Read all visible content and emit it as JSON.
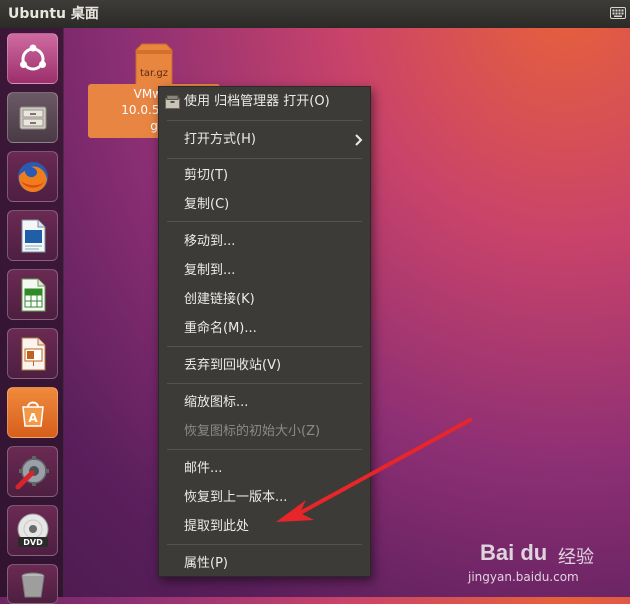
{
  "top_panel": {
    "title": "Ubuntu 桌面",
    "keyboard_icon": "keyboard-icon"
  },
  "launcher": {
    "items": [
      {
        "name": "ubuntu-dash-icon"
      },
      {
        "name": "files-icon"
      },
      {
        "name": "firefox-icon"
      },
      {
        "name": "writer-icon"
      },
      {
        "name": "calc-icon"
      },
      {
        "name": "impress-icon"
      },
      {
        "name": "software-center-icon"
      },
      {
        "name": "system-settings-icon"
      },
      {
        "name": "dvd-icon"
      },
      {
        "name": "trash-icon"
      }
    ]
  },
  "desktop_file": {
    "icon_text": "tar.gz",
    "label_line1": "VMwar",
    "label_line2": "10.0.5-322",
    "label_line3": "g"
  },
  "context_menu": {
    "items": [
      {
        "label": "使用 归档管理器 打开(O)",
        "icon": "archive-manager-icon"
      },
      {
        "label": "打开方式(H)",
        "submenu": true
      },
      {
        "label": "剪切(T)"
      },
      {
        "label": "复制(C)"
      },
      {
        "label": "移动到..."
      },
      {
        "label": "复制到..."
      },
      {
        "label": "创建链接(K)"
      },
      {
        "label": "重命名(M)..."
      },
      {
        "label": "丢弃到回收站(V)"
      },
      {
        "label": "缩放图标..."
      },
      {
        "label": "恢复图标的初始大小(Z)",
        "disabled": true
      },
      {
        "label": "邮件..."
      },
      {
        "label": "恢复到上一版本..."
      },
      {
        "label": "提取到此处"
      },
      {
        "label": "属性(P)"
      }
    ]
  },
  "annotation": {
    "color": "#e8262a"
  },
  "watermark": {
    "logo": "Bai du",
    "cn": "经验",
    "url": "jingyan.baidu.com"
  },
  "colors": {
    "panel": "#2b2a27",
    "menu_bg": "#3d3b37",
    "selection": "#e88543"
  }
}
